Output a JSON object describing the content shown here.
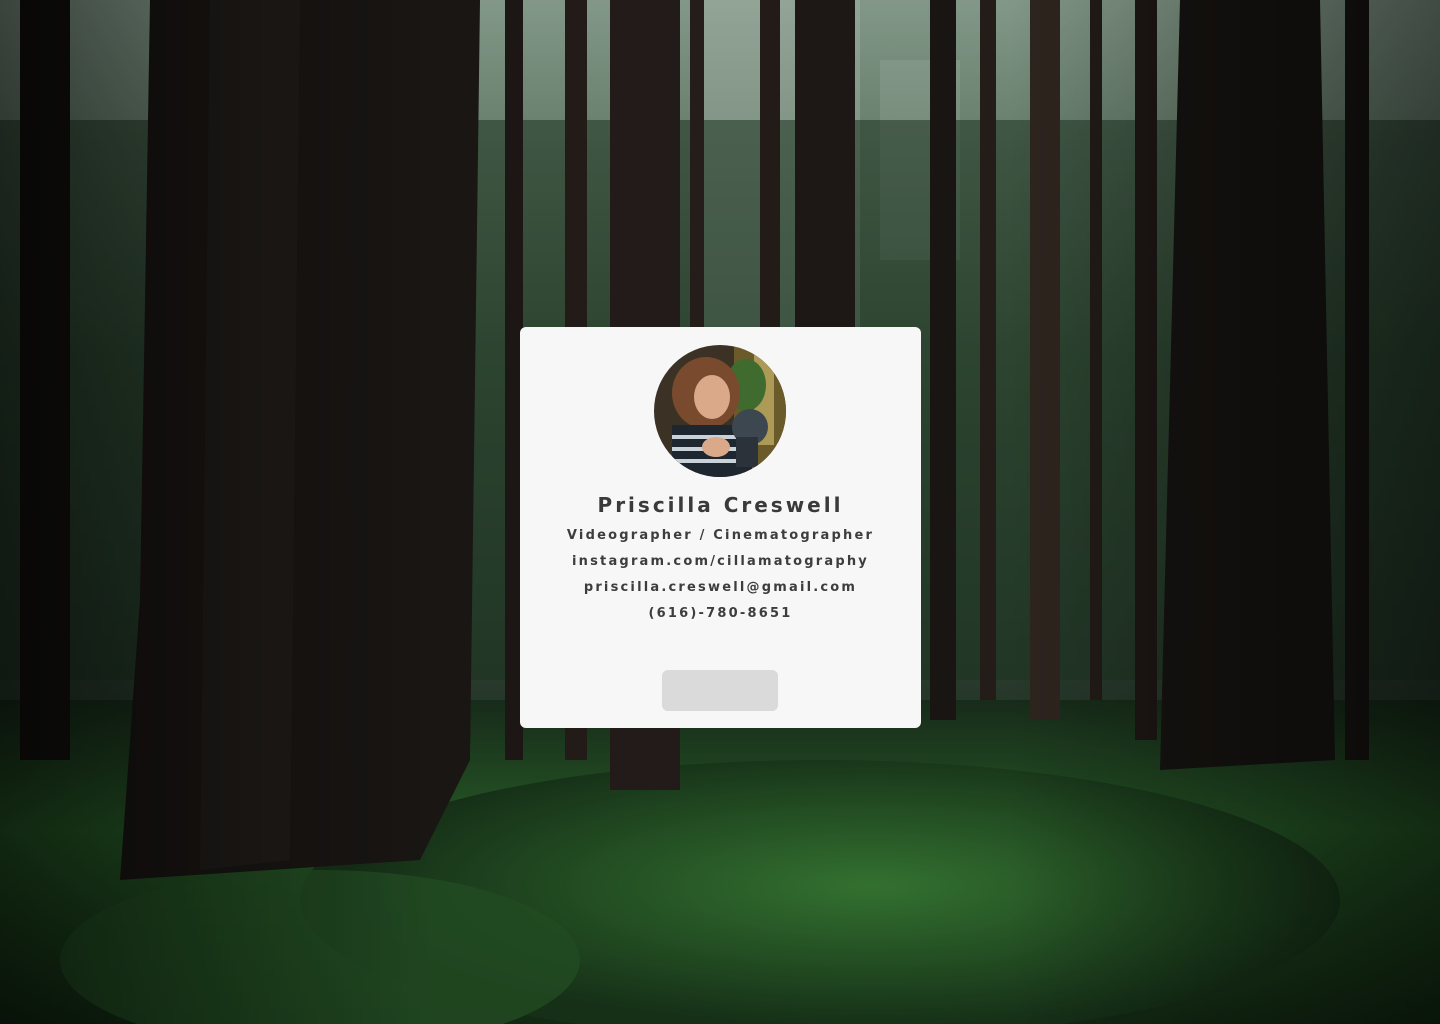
{
  "background": {
    "image": "redwood-forest-photo",
    "colors": {
      "canopy": "#1c2a22",
      "trunk": "#2a2420",
      "moss": "#2f6a2c",
      "light": "#cfe3d6"
    }
  },
  "card": {
    "avatar": {
      "image": "portrait-photo-woman-with-camera"
    },
    "name": "Priscilla Creswell",
    "role": "Videographer / Cinematographer",
    "instagram": "instagram.com/cillamatography",
    "email": "priscilla.creswell@gmail.com",
    "phone": "(616)-780-8651",
    "button_label": ""
  }
}
